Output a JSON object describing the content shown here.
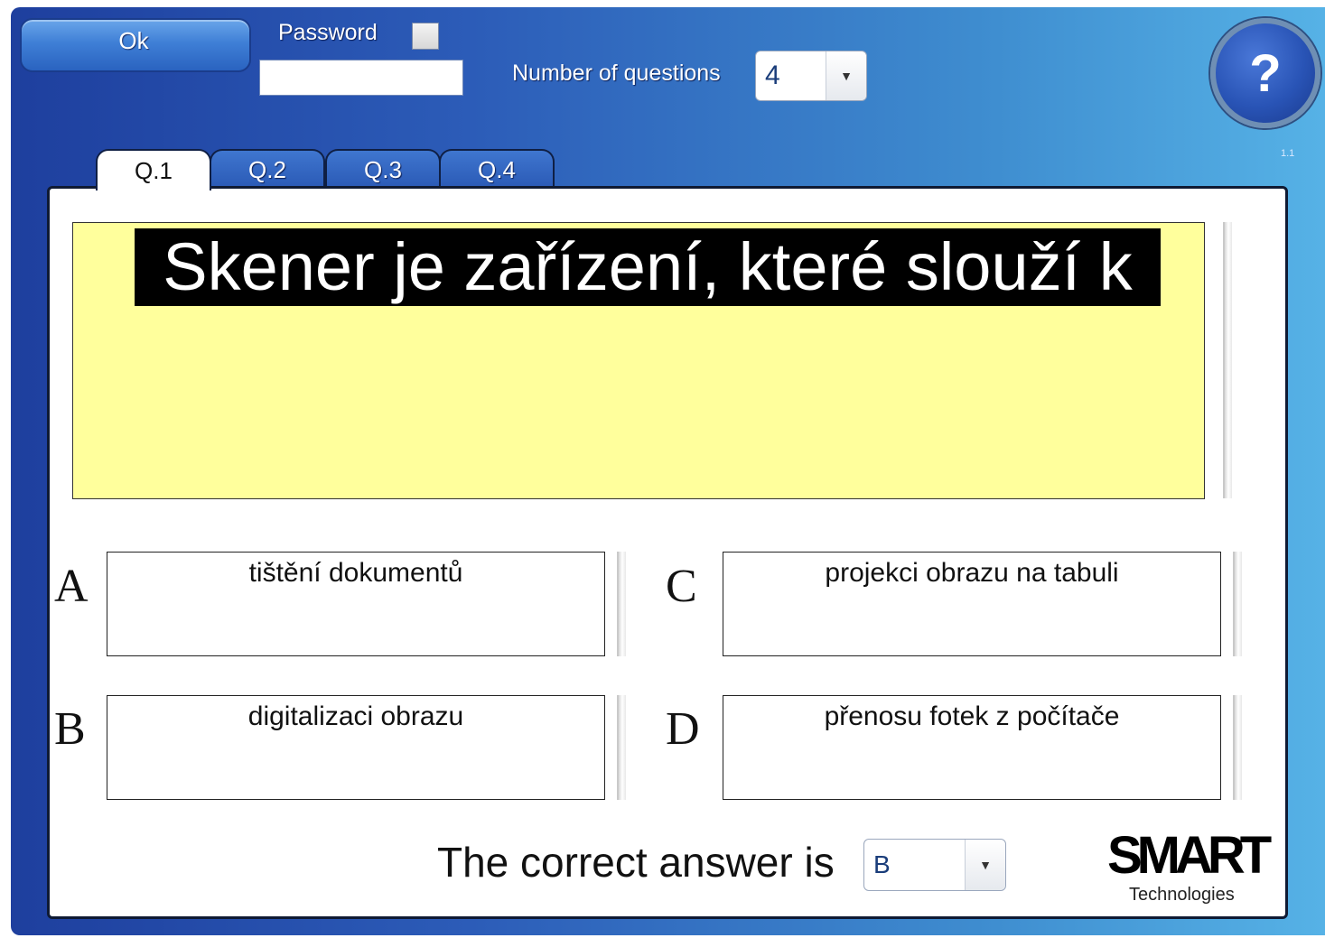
{
  "toolbar": {
    "ok_label": "Ok",
    "password_label": "Password",
    "password_value": "",
    "num_questions_label": "Number of questions",
    "num_questions_value": "4",
    "help_symbol": "?",
    "version": "1.1"
  },
  "tabs": [
    {
      "label": "Q.1",
      "active": true
    },
    {
      "label": "Q.2",
      "active": false
    },
    {
      "label": "Q.3",
      "active": false
    },
    {
      "label": "Q.4",
      "active": false
    }
  ],
  "question": {
    "text": "Skener je zařízení, které slouží k"
  },
  "answers": [
    {
      "letter": "A",
      "text": "tištění dokumentů"
    },
    {
      "letter": "B",
      "text": "digitalizaci obrazu"
    },
    {
      "letter": "C",
      "text": "projekci obrazu na tabuli"
    },
    {
      "letter": "D",
      "text": "přenosu fotek z počítače"
    }
  ],
  "correct": {
    "label": "The correct answer is",
    "value": "B"
  },
  "branding": {
    "logo_text": "SMART",
    "subtitle": "Technologies"
  },
  "colors": {
    "question_bg": "#ffff9c",
    "frame_start": "#1e3f9e",
    "frame_end": "#56b2e6"
  }
}
